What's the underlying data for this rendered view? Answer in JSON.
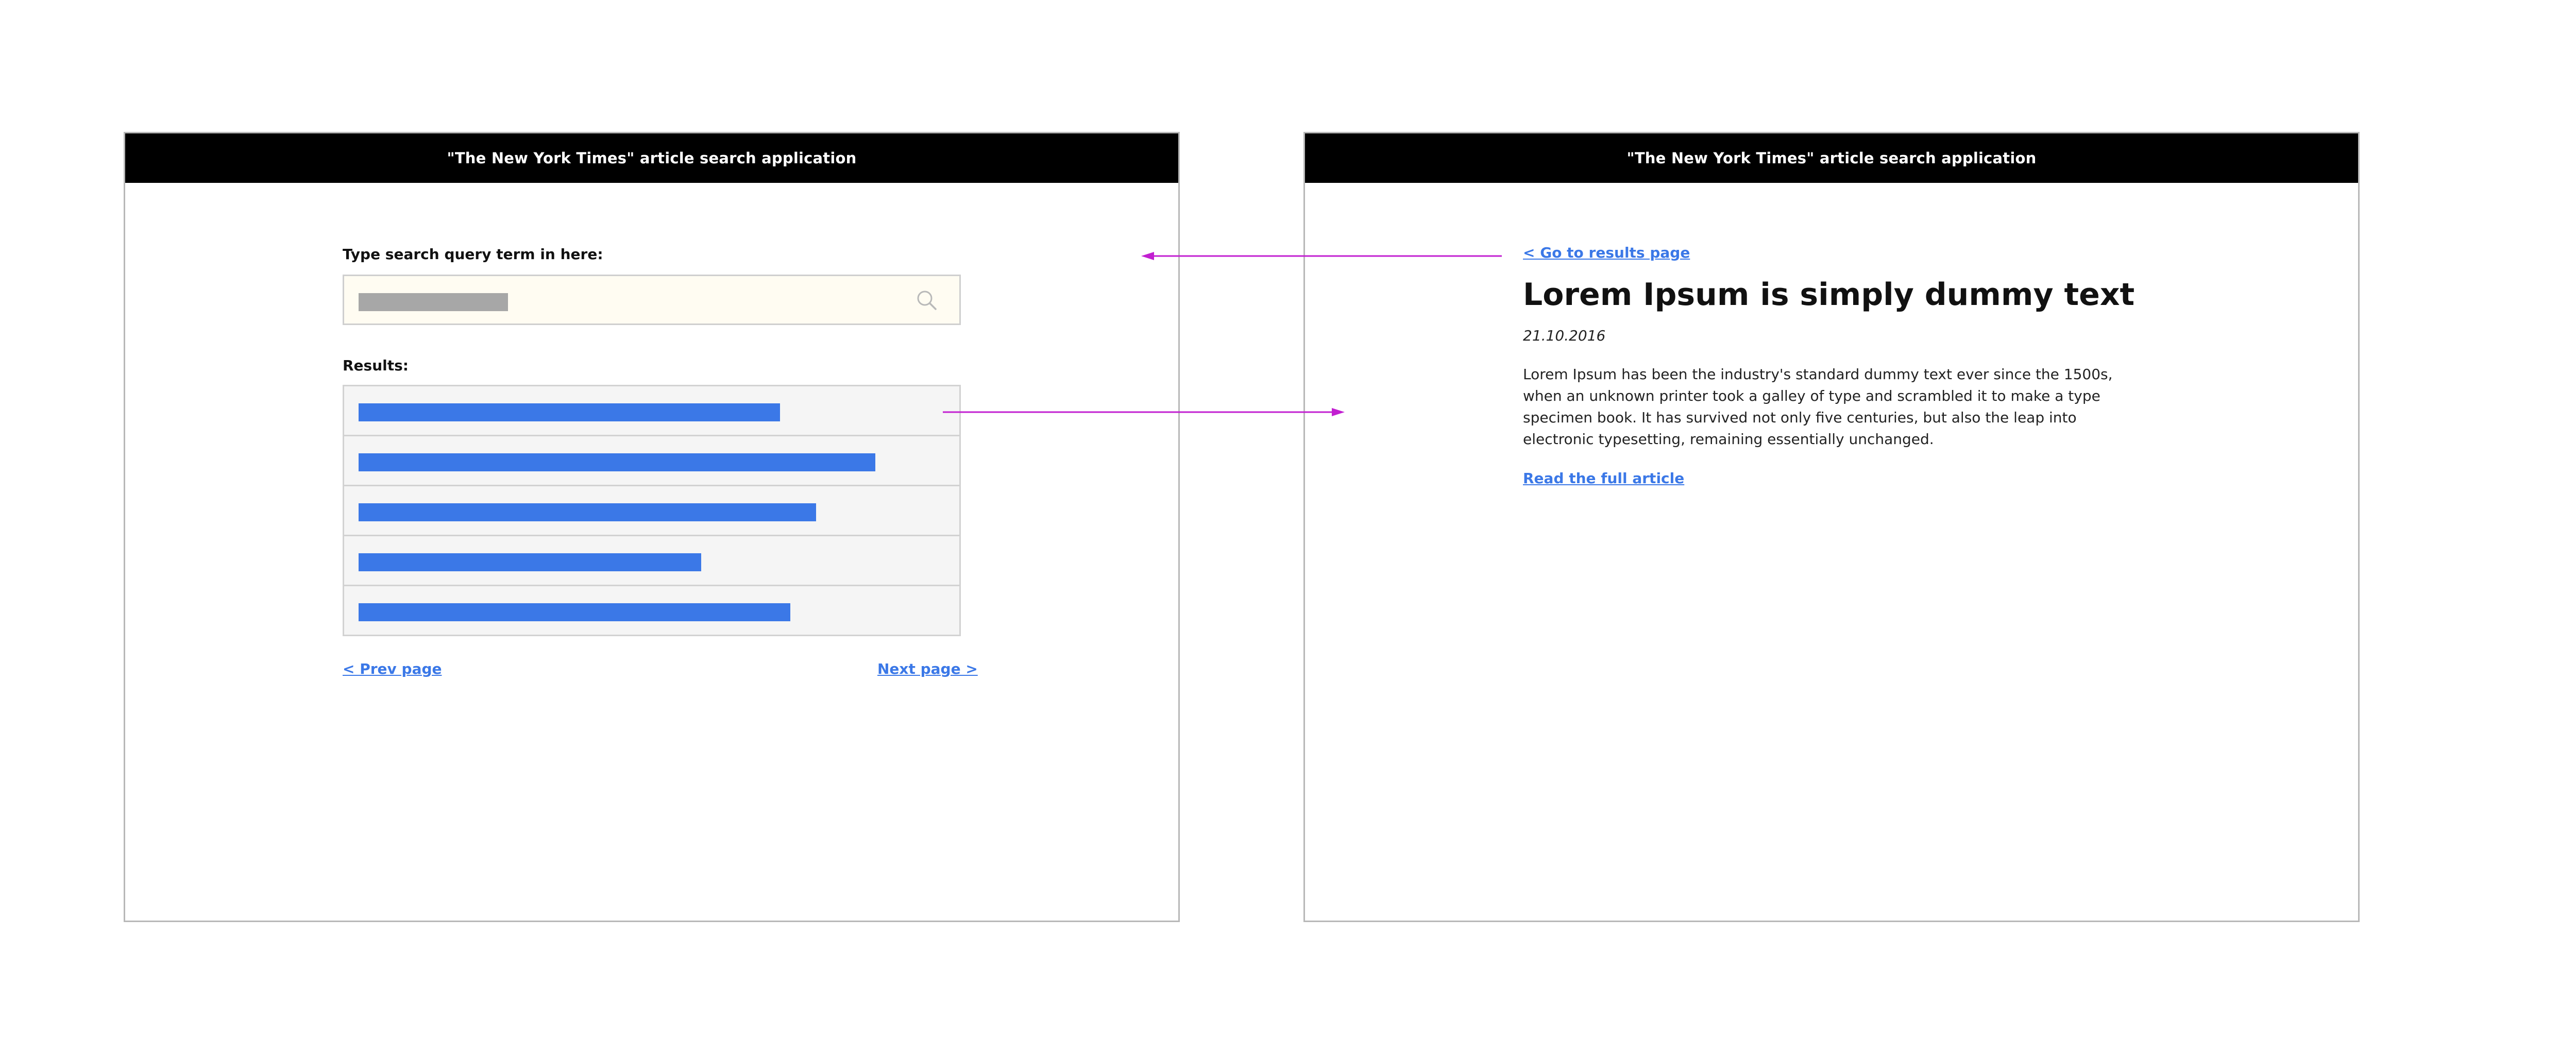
{
  "app_title": "\"The New York Times\" article search application",
  "search_screen": {
    "search_label": "Type search query term in here:",
    "results_label": "Results:",
    "result_count": 5,
    "prev_label": "< Prev page",
    "next_label": "Next page >"
  },
  "article_screen": {
    "back_label": "< Go to results page",
    "title": "Lorem Ipsum is simply dummy text",
    "date": "21.10.2016",
    "body": "Lorem Ipsum has been the industry's standard dummy text ever since the 1500s, when an unknown printer took a galley of type and scrambled it to make a type specimen book. It has survived not only five centuries, but also the leap into electronic typesetting, remaining essentially unchanged.",
    "read_more_label": "Read the full article"
  },
  "colors": {
    "header_bg": "#000000",
    "link": "#3b78e7",
    "result_bar": "#3b78e7",
    "placeholder_bar": "#a7a7a7",
    "arrow": "#c21fd1"
  },
  "icons": {
    "search": "search-icon",
    "arrow_head": "arrow-head-icon"
  }
}
